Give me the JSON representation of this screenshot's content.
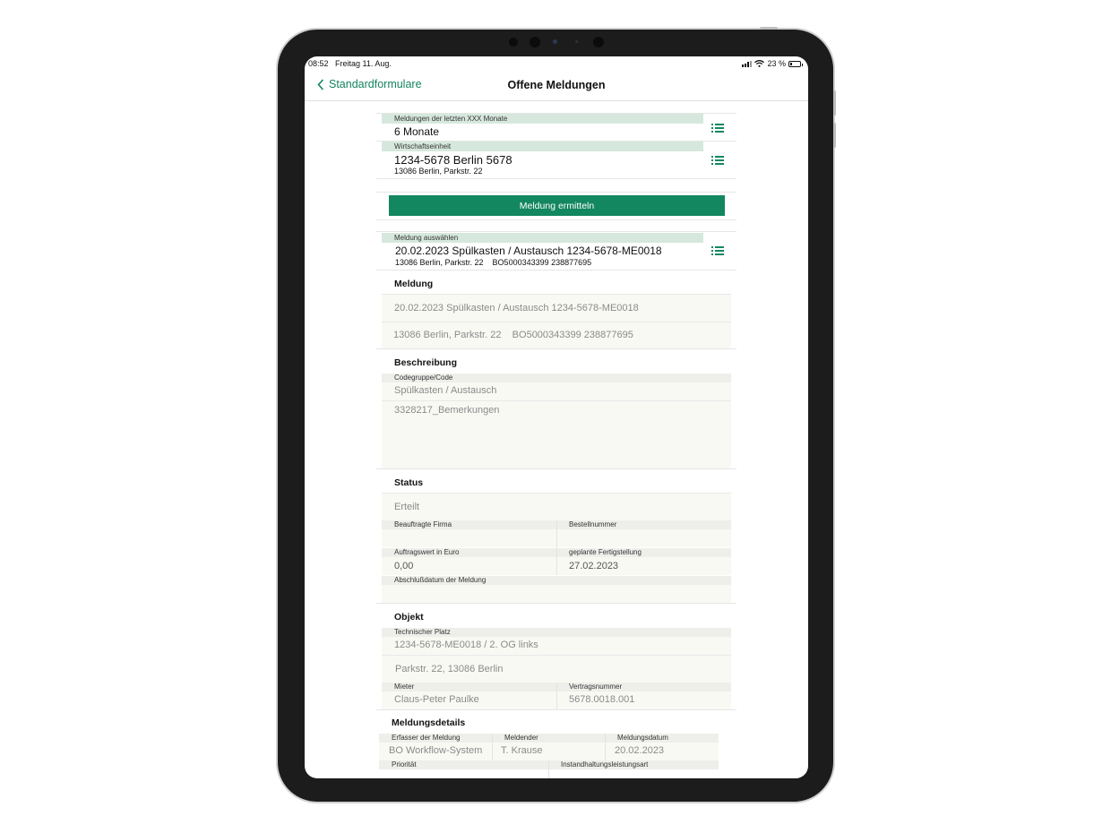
{
  "status_bar": {
    "time": "08:52",
    "date": "Freitag 11. Aug.",
    "battery_text": "23 %",
    "battery_level": 0.23
  },
  "nav": {
    "back_label": "Standardformulare",
    "title": "Offene Meldungen"
  },
  "filters": {
    "months": {
      "label": "Meldungen der letzten XXX Monate",
      "value": "6 Monate"
    },
    "unit": {
      "label": "Wirtschaftseinheit",
      "value": "1234-5678 Berlin 5678",
      "sub": "13086 Berlin, Parkstr. 22"
    }
  },
  "action_button": "Meldung ermitteln",
  "selection": {
    "label": "Meldung auswählen",
    "value": "20.02.2023 Spülkasten / Austausch 1234-5678-ME0018",
    "sub": "13086 Berlin, Parkstr. 22    BO5000343399 238877695"
  },
  "meldung": {
    "title": "Meldung",
    "line1": "20.02.2023 Spülkasten / Austausch 1234-5678-ME0018",
    "line2": "13086 Berlin, Parkstr. 22    BO5000343399 238877695"
  },
  "beschreibung": {
    "title": "Beschreibung",
    "code_label": "Codegruppe/Code",
    "code_value": "Spülkasten / Austausch",
    "remarks": "3328217_Bemerkungen"
  },
  "status": {
    "title": "Status",
    "value": "Erteilt",
    "firm_label": "Beauftragte Firma",
    "firm_value": "",
    "order_label": "Bestellnummer",
    "order_value": "",
    "amount_label": "Auftragswert in Euro",
    "amount_value": "0,00",
    "planned_label": "geplante Fertigstellung",
    "planned_value": "27.02.2023",
    "closing_label": "Abschlußdatum der Meldung",
    "closing_value": ""
  },
  "objekt": {
    "title": "Objekt",
    "place_label": "Technischer Platz",
    "place_value": "1234-5678-ME0018 / 2. OG links",
    "address": "Parkstr. 22, 13086 Berlin",
    "tenant_label": "Mieter",
    "tenant_value": "Claus-Peter Paulke",
    "contract_label": "Vertragsnummer",
    "contract_value": "5678.0018.001"
  },
  "details": {
    "title": "Meldungsdetails",
    "creator_label": "Erfasser der Meldung",
    "creator_value": "BO Workflow-System",
    "reporter_label": "Meldender",
    "reporter_value": "T. Krause",
    "date_label": "Meldungsdatum",
    "date_value": "20.02.2023",
    "priority_label": "Priorität",
    "maint_label": "Instandhaltungsleistungsart"
  },
  "colors": {
    "accent": "#13875f",
    "label_strip": "#d6e8de",
    "field_bg": "#f9f9f4"
  }
}
